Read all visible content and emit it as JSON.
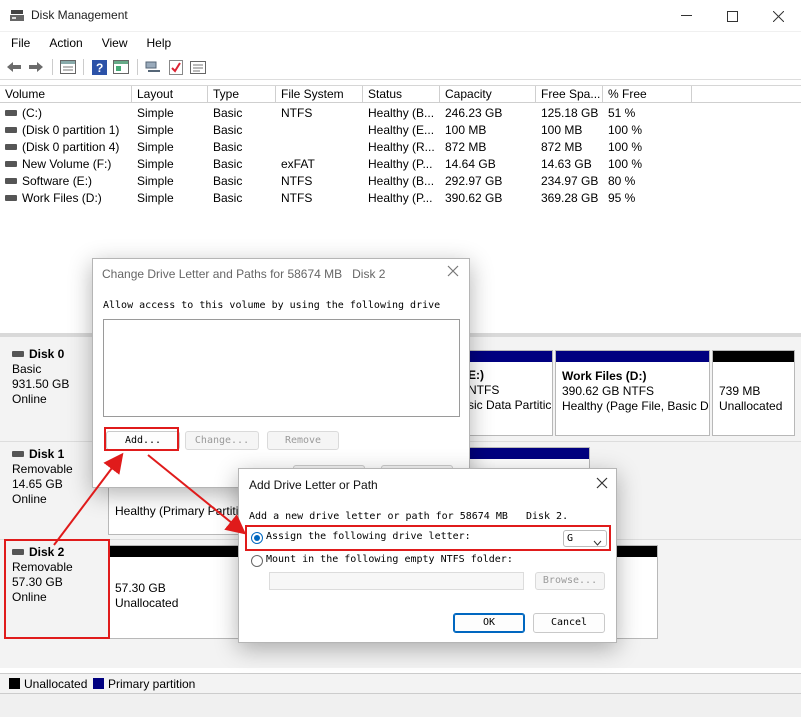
{
  "window": {
    "title": "Disk Management"
  },
  "menu": [
    "File",
    "Action",
    "View",
    "Help"
  ],
  "toolbar_icons": [
    "back-arrow-icon",
    "forward-arrow-icon",
    "list-view-icon",
    "help-icon",
    "disk-view-icon",
    "connect-icon",
    "check-icon",
    "properties-icon"
  ],
  "columns": [
    "Volume",
    "Layout",
    "Type",
    "File System",
    "Status",
    "Capacity",
    "Free Spa...",
    "% Free"
  ],
  "volumes": [
    [
      "(C:)",
      "Simple",
      "Basic",
      "NTFS",
      "Healthy (B...",
      "246.23 GB",
      "125.18 GB",
      "51 %"
    ],
    [
      "(Disk 0 partition 1)",
      "Simple",
      "Basic",
      "",
      "Healthy (E...",
      "100 MB",
      "100 MB",
      "100 %"
    ],
    [
      "(Disk 0 partition 4)",
      "Simple",
      "Basic",
      "",
      "Healthy (R...",
      "872 MB",
      "872 MB",
      "100 %"
    ],
    [
      "New Volume (F:)",
      "Simple",
      "Basic",
      "exFAT",
      "Healthy (P...",
      "14.64 GB",
      "14.63 GB",
      "100 %"
    ],
    [
      "Software (E:)",
      "Simple",
      "Basic",
      "NTFS",
      "Healthy (B...",
      "292.97 GB",
      "234.97 GB",
      "80 %"
    ],
    [
      "Work Files (D:)",
      "Simple",
      "Basic",
      "NTFS",
      "Healthy (P...",
      "390.62 GB",
      "369.28 GB",
      "95 %"
    ]
  ],
  "disks": {
    "disk0": {
      "name": "Disk 0",
      "type": "Basic",
      "size": "931.50 GB",
      "status": "Online",
      "p_e": {
        "title": "E:)",
        "line1": "NTFS",
        "line2": "sic Data Partitic"
      },
      "p_d": {
        "title": "Work Files  (D:)",
        "line1": "390.62 GB NTFS",
        "line2": "Healthy (Page File, Basic Da"
      },
      "p_un": {
        "line1": "739 MB",
        "line2": "Unallocated"
      }
    },
    "disk1": {
      "name": "Disk 1",
      "type": "Removable",
      "size": "14.65 GB",
      "status": "Online",
      "p_f": {
        "line2": "Healthy (Primary Partitio"
      }
    },
    "disk2": {
      "name": "Disk 2",
      "type": "Removable",
      "size": "57.30 GB",
      "status": "Online",
      "p_un": {
        "line1": "57.30 GB",
        "line2": "Unallocated"
      }
    }
  },
  "legend": {
    "unallocated": "Unallocated",
    "primary": "Primary partition",
    "unallocated_color": "#000000",
    "primary_color": "#000080"
  },
  "dialog1": {
    "title": "Change Drive Letter and Paths for 58674 MB   Disk 2",
    "prompt": "Allow access to this volume by using the following drive",
    "add": "Add...",
    "change": "Change...",
    "remove": "Remove"
  },
  "dialog2": {
    "title": "Add Drive Letter or Path",
    "prompt": "Add a new drive letter or path for 58674 MB   Disk 2.",
    "assign_label": "Assign the following drive letter:",
    "assign_value": "G",
    "mount_label": "Mount in the following empty NTFS folder:",
    "browse": "Browse...",
    "ok": "OK",
    "cancel": "Cancel"
  },
  "colors": {
    "highlight": "#e01b1b",
    "partition_blue": "#000080",
    "accent": "#0067c0"
  }
}
